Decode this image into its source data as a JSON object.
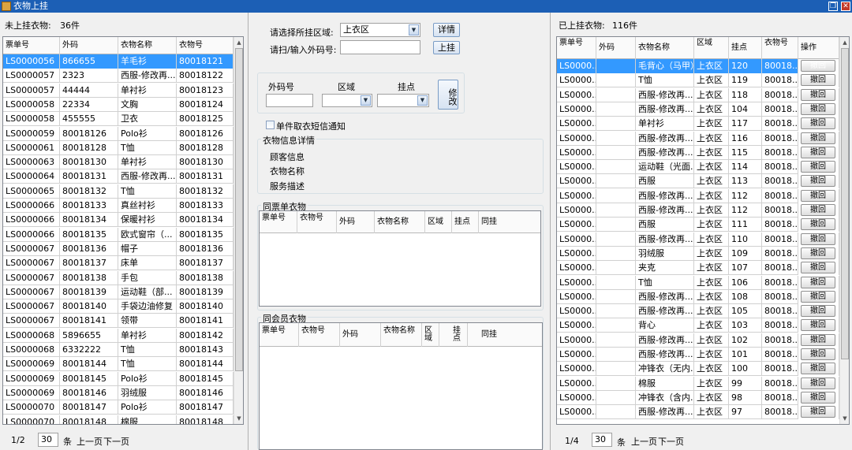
{
  "window": {
    "title": "衣物上挂"
  },
  "left": {
    "count_label": "未上挂衣物:",
    "count_value": "36件",
    "columns": [
      "票单号",
      "外码",
      "衣物名称",
      "衣物号"
    ],
    "rows": [
      [
        "LS0000056",
        "866655",
        "羊毛衫",
        "80018121"
      ],
      [
        "LS0000057",
        "2323",
        "西服-修改再...",
        "80018122"
      ],
      [
        "LS0000057",
        "44444",
        "单衬衫",
        "80018123"
      ],
      [
        "LS0000058",
        "22334",
        "文胸",
        "80018124"
      ],
      [
        "LS0000058",
        "455555",
        "卫衣",
        "80018125"
      ],
      [
        "LS0000059",
        "80018126",
        "Polo衫",
        "80018126"
      ],
      [
        "LS0000061",
        "80018128",
        "T恤",
        "80018128"
      ],
      [
        "LS0000063",
        "80018130",
        "单衬衫",
        "80018130"
      ],
      [
        "LS0000064",
        "80018131",
        "西服-修改再...",
        "80018131"
      ],
      [
        "LS0000065",
        "80018132",
        "T恤",
        "80018132"
      ],
      [
        "LS0000066",
        "80018133",
        "真丝衬衫",
        "80018133"
      ],
      [
        "LS0000066",
        "80018134",
        "保暖衬衫",
        "80018134"
      ],
      [
        "LS0000066",
        "80018135",
        "欧式窗帘（...",
        "80018135"
      ],
      [
        "LS0000067",
        "80018136",
        "帽子",
        "80018136"
      ],
      [
        "LS0000067",
        "80018137",
        "床单",
        "80018137"
      ],
      [
        "LS0000067",
        "80018138",
        "手包",
        "80018138"
      ],
      [
        "LS0000067",
        "80018139",
        "运动鞋（部...",
        "80018139"
      ],
      [
        "LS0000067",
        "80018140",
        "手袋边油修复",
        "80018140"
      ],
      [
        "LS0000067",
        "80018141",
        "领带",
        "80018141"
      ],
      [
        "LS0000068",
        "5896655",
        "单衬衫",
        "80018142"
      ],
      [
        "LS0000068",
        "6332222",
        "T恤",
        "80018143"
      ],
      [
        "LS0000069",
        "80018144",
        "T恤",
        "80018144"
      ],
      [
        "LS0000069",
        "80018145",
        "Polo衫",
        "80018145"
      ],
      [
        "LS0000069",
        "80018146",
        "羽绒服",
        "80018146"
      ],
      [
        "LS0000070",
        "80018147",
        "Polo衫",
        "80018147"
      ],
      [
        "LS0000070",
        "80018148",
        "棉服",
        "80018148"
      ]
    ],
    "pager": {
      "page": "1/2",
      "size": "30",
      "unit": "条",
      "prev": "上一页",
      "next": "下一页"
    }
  },
  "middle": {
    "area_label": "请选择所挂区域:",
    "area_value": "上衣区",
    "detail_button": "详情",
    "scan_label": "请扫/输入外码号:",
    "hang_button": "上挂",
    "edit": {
      "code_label": "外码号",
      "area_label": "区域",
      "point_label": "挂点",
      "button": "修改"
    },
    "sms_label": "单件取衣短信通知",
    "info": {
      "title": "衣物信息详情",
      "customer": "顾客信息",
      "name": "衣物名称",
      "service": "服务描述"
    },
    "same_ticket": {
      "title": "同票单衣物",
      "columns": [
        "票单号",
        "衣物号",
        "外码",
        "衣物名称",
        "区域",
        "挂点",
        "同挂"
      ]
    },
    "same_member": {
      "title": "同会员衣物",
      "columns": [
        "票单号",
        "衣物号",
        "外码",
        "衣物名称",
        "区域",
        "挂点",
        "同挂"
      ]
    }
  },
  "right": {
    "count_label": "已上挂衣物:",
    "count_value": "116件",
    "columns": [
      "票单号",
      "外码",
      "衣物名称",
      "区域",
      "挂点",
      "衣物号",
      "操作"
    ],
    "op_label": "撤回",
    "rows": [
      [
        "LS0000...",
        "",
        "毛背心（马甲）",
        "上衣区",
        "120",
        "80018..."
      ],
      [
        "LS0000...",
        "",
        "T恤",
        "上衣区",
        "119",
        "80018..."
      ],
      [
        "LS0000...",
        "",
        "西服-修改再...",
        "上衣区",
        "118",
        "80018..."
      ],
      [
        "LS0000...",
        "",
        "西服-修改再...",
        "上衣区",
        "104",
        "80018..."
      ],
      [
        "LS0000...",
        "",
        "单衬衫",
        "上衣区",
        "117",
        "80018..."
      ],
      [
        "LS0000...",
        "",
        "西服-修改再...",
        "上衣区",
        "116",
        "80018..."
      ],
      [
        "LS0000...",
        "",
        "西服-修改再...",
        "上衣区",
        "115",
        "80018..."
      ],
      [
        "LS0000...",
        "",
        "运动鞋（光面...",
        "上衣区",
        "114",
        "80018..."
      ],
      [
        "LS0000...",
        "",
        "西服",
        "上衣区",
        "113",
        "80018..."
      ],
      [
        "LS0000...",
        "",
        "西服-修改再...",
        "上衣区",
        "112",
        "80018..."
      ],
      [
        "LS0000...",
        "",
        "西服-修改再...",
        "上衣区",
        "112",
        "80018..."
      ],
      [
        "LS0000...",
        "",
        "西服",
        "上衣区",
        "111",
        "80018..."
      ],
      [
        "LS0000...",
        "",
        "西服-修改再...",
        "上衣区",
        "110",
        "80018..."
      ],
      [
        "LS0000...",
        "",
        "羽绒服",
        "上衣区",
        "109",
        "80018..."
      ],
      [
        "LS0000...",
        "",
        "夹克",
        "上衣区",
        "107",
        "80018..."
      ],
      [
        "LS0000...",
        "",
        "T恤",
        "上衣区",
        "106",
        "80018..."
      ],
      [
        "LS0000...",
        "",
        "西服-修改再...",
        "上衣区",
        "108",
        "80018..."
      ],
      [
        "LS0000...",
        "",
        "西服-修改再...",
        "上衣区",
        "105",
        "80018..."
      ],
      [
        "LS0000...",
        "",
        "背心",
        "上衣区",
        "103",
        "80018..."
      ],
      [
        "LS0000...",
        "",
        "西服-修改再...",
        "上衣区",
        "102",
        "80018..."
      ],
      [
        "LS0000...",
        "",
        "西服-修改再...",
        "上衣区",
        "101",
        "80018..."
      ],
      [
        "LS0000...",
        "",
        "冲锋衣（无内...",
        "上衣区",
        "100",
        "80018..."
      ],
      [
        "LS0000...",
        "",
        "棉服",
        "上衣区",
        "99",
        "80018..."
      ],
      [
        "LS0000...",
        "",
        "冲锋衣（含内...",
        "上衣区",
        "98",
        "80018..."
      ],
      [
        "LS0000...",
        "",
        "西服-修改再...",
        "上衣区",
        "97",
        "80018..."
      ]
    ],
    "pager": {
      "page": "1/4",
      "size": "30",
      "unit": "条",
      "prev": "上一页",
      "next": "下一页"
    }
  },
  "colors": {
    "selection": "#3399ff",
    "titlebar": "#1c5fb5"
  }
}
